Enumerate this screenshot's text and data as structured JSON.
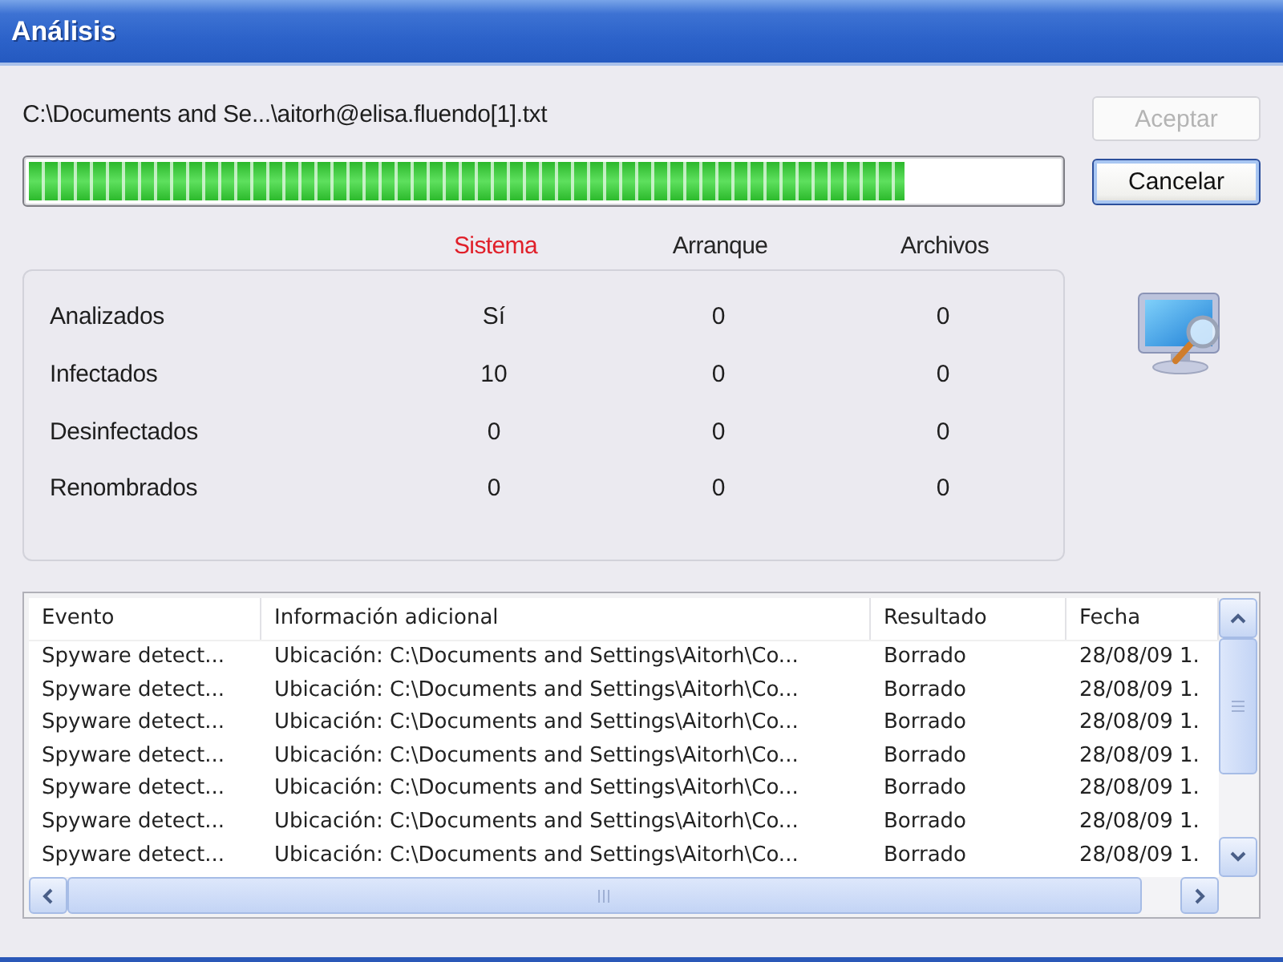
{
  "window": {
    "title": "Análisis"
  },
  "current_file": "C:\\Documents and Se...\\aitorh@elisa.fluendo[1].txt",
  "progress": {
    "level": 0.85
  },
  "buttons": [
    {
      "label": "Aceptar",
      "disabled": true,
      "default": false
    },
    {
      "label": "Cancelar",
      "disabled": false,
      "default": true
    }
  ],
  "summary": {
    "columns": [
      {
        "label": "Sistema",
        "active": true
      },
      {
        "label": "Arranque",
        "active": false
      },
      {
        "label": "Archivos",
        "active": false
      }
    ],
    "rows": [
      {
        "label": "Analizados",
        "values": [
          "Sí",
          "0",
          "0"
        ]
      },
      {
        "label": "Infectados",
        "values": [
          "10",
          "0",
          "0"
        ]
      },
      {
        "label": "Desinfectados",
        "values": [
          "0",
          "0",
          "0"
        ]
      },
      {
        "label": "Renombrados",
        "values": [
          "0",
          "0",
          "0"
        ]
      }
    ]
  },
  "events": {
    "columns": [
      "Evento",
      "Información adicional",
      "Resultado",
      "Fecha"
    ],
    "rows": [
      [
        "Spyware detect...",
        "Ubicación: C:\\Documents and Settings\\Aitorh\\Co...",
        "Borrado",
        "28/08/09 1."
      ],
      [
        "Spyware detect...",
        "Ubicación: C:\\Documents and Settings\\Aitorh\\Co...",
        "Borrado",
        "28/08/09 1."
      ],
      [
        "Spyware detect...",
        "Ubicación: C:\\Documents and Settings\\Aitorh\\Co...",
        "Borrado",
        "28/08/09 1."
      ],
      [
        "Spyware detect...",
        "Ubicación: C:\\Documents and Settings\\Aitorh\\Co...",
        "Borrado",
        "28/08/09 1."
      ],
      [
        "Spyware detect...",
        "Ubicación: C:\\Documents and Settings\\Aitorh\\Co...",
        "Borrado",
        "28/08/09 1."
      ],
      [
        "Spyware detect...",
        "Ubicación: C:\\Documents and Settings\\Aitorh\\Co...",
        "Borrado",
        "28/08/09 1."
      ],
      [
        "Spyware detect...",
        "Ubicación: C:\\Documents and Settings\\Aitorh\\Co...",
        "Borrado",
        "28/08/09 1."
      ]
    ]
  }
}
